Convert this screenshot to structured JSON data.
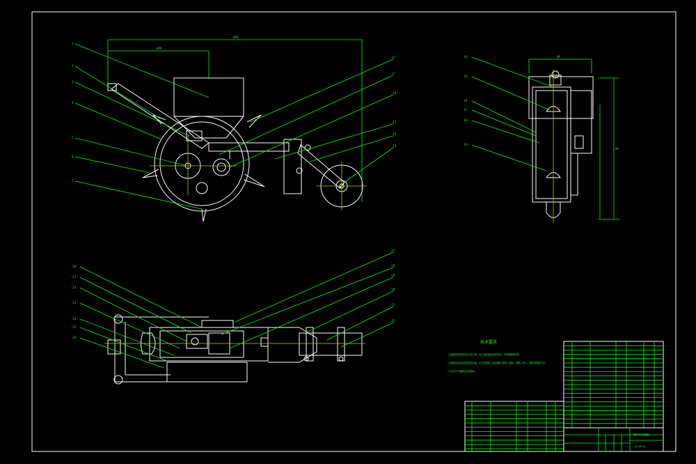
{
  "colors": {
    "background": "#000000",
    "outline": "#ffffff",
    "dimension": "#00ff00",
    "center": "#c8c800"
  },
  "notes": {
    "title": "技术要求",
    "lines": [
      "1.装配前所有零件应清洗干净，各个配合面应涂润滑油，不得有磕碰划伤。",
      "2.装配后各运动件应转动灵活，无卡滞现象，各连接处 螺钉、螺栓、垫圈、垫片、螺母应紧固可靠。",
      "3.未注尺寸按图示比例绘制。"
    ]
  },
  "front_view": {
    "callouts": [
      "1",
      "2",
      "3",
      "4",
      "5",
      "6",
      "7",
      "8",
      "9",
      "10",
      "11",
      "12",
      "13"
    ],
    "dims": [
      "###",
      "###"
    ]
  },
  "side_view": {
    "callouts": [
      "14",
      "15",
      "16",
      "17",
      "18",
      "19"
    ],
    "dims": [
      "##",
      "##"
    ]
  },
  "top_view": {
    "callouts": [
      "20",
      "21",
      "22",
      "23",
      "24",
      "25",
      "26",
      "27",
      "28",
      "29",
      "30",
      "31",
      "32"
    ]
  },
  "title_block": {
    "part_name": "播种机总装配图",
    "drawing_no": "BZ-00-00"
  }
}
